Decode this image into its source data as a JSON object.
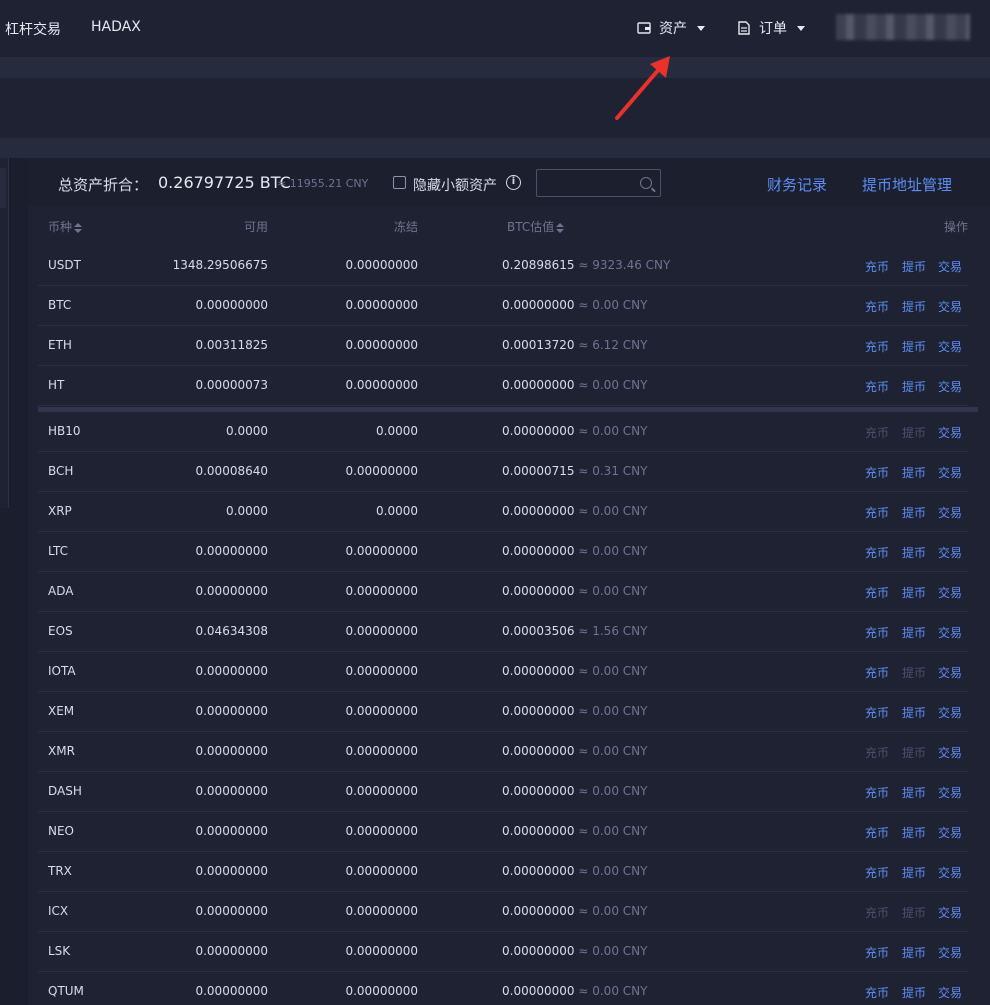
{
  "nav": {
    "margin_trade": "杠杆交易",
    "hadax": "HADAX",
    "assets": "资产",
    "orders": "订单"
  },
  "summary": {
    "label": "总资产折合：",
    "btc_value": "0.26797725 BTC",
    "cny_value": "≈ 11955.21 CNY",
    "hide_small": "隐藏小额资产",
    "search_placeholder": "",
    "finance_records": "财务记录",
    "withdraw_address": "提币地址管理"
  },
  "table": {
    "headers": {
      "coin": "币种",
      "available": "可用",
      "frozen": "冻结",
      "btc_valuation": "BTC估值",
      "actions": "操作"
    },
    "action_labels": {
      "deposit": "充币",
      "withdraw": "提币",
      "trade": "交易"
    },
    "rows": [
      {
        "coin": "USDT",
        "available": "1348.29506675",
        "frozen": "0.00000000",
        "btc": "0.20898615",
        "cny": "≈ 9323.46 CNY",
        "enabled": true
      },
      {
        "coin": "BTC",
        "available": "0.00000000",
        "frozen": "0.00000000",
        "btc": "0.00000000",
        "cny": "≈ 0.00 CNY",
        "enabled": true
      },
      {
        "coin": "ETH",
        "available": "0.00311825",
        "frozen": "0.00000000",
        "btc": "0.00013720",
        "cny": "≈ 6.12 CNY",
        "enabled": true
      },
      {
        "coin": "HT",
        "available": "0.00000073",
        "frozen": "0.00000000",
        "btc": "0.00000000",
        "cny": "≈ 0.00 CNY",
        "enabled": true
      },
      {
        "coin": "HB10",
        "available": "0.0000",
        "frozen": "0.0000",
        "btc": "0.00000000",
        "cny": "≈ 0.00 CNY",
        "enabled": false
      },
      {
        "coin": "BCH",
        "available": "0.00008640",
        "frozen": "0.00000000",
        "btc": "0.00000715",
        "cny": "≈ 0.31 CNY",
        "enabled": true
      },
      {
        "coin": "XRP",
        "available": "0.0000",
        "frozen": "0.0000",
        "btc": "0.00000000",
        "cny": "≈ 0.00 CNY",
        "enabled": true
      },
      {
        "coin": "LTC",
        "available": "0.00000000",
        "frozen": "0.00000000",
        "btc": "0.00000000",
        "cny": "≈ 0.00 CNY",
        "enabled": true
      },
      {
        "coin": "ADA",
        "available": "0.00000000",
        "frozen": "0.00000000",
        "btc": "0.00000000",
        "cny": "≈ 0.00 CNY",
        "enabled": true
      },
      {
        "coin": "EOS",
        "available": "0.04634308",
        "frozen": "0.00000000",
        "btc": "0.00003506",
        "cny": "≈ 1.56 CNY",
        "enabled": true
      },
      {
        "coin": "IOTA",
        "available": "0.00000000",
        "frozen": "0.00000000",
        "btc": "0.00000000",
        "cny": "≈ 0.00 CNY",
        "enabled": "partial"
      },
      {
        "coin": "XEM",
        "available": "0.00000000",
        "frozen": "0.00000000",
        "btc": "0.00000000",
        "cny": "≈ 0.00 CNY",
        "enabled": true
      },
      {
        "coin": "XMR",
        "available": "0.00000000",
        "frozen": "0.00000000",
        "btc": "0.00000000",
        "cny": "≈ 0.00 CNY",
        "enabled": false
      },
      {
        "coin": "DASH",
        "available": "0.00000000",
        "frozen": "0.00000000",
        "btc": "0.00000000",
        "cny": "≈ 0.00 CNY",
        "enabled": true
      },
      {
        "coin": "NEO",
        "available": "0.00000000",
        "frozen": "0.00000000",
        "btc": "0.00000000",
        "cny": "≈ 0.00 CNY",
        "enabled": true
      },
      {
        "coin": "TRX",
        "available": "0.00000000",
        "frozen": "0.00000000",
        "btc": "0.00000000",
        "cny": "≈ 0.00 CNY",
        "enabled": true
      },
      {
        "coin": "ICX",
        "available": "0.00000000",
        "frozen": "0.00000000",
        "btc": "0.00000000",
        "cny": "≈ 0.00 CNY",
        "enabled": false
      },
      {
        "coin": "LSK",
        "available": "0.00000000",
        "frozen": "0.00000000",
        "btc": "0.00000000",
        "cny": "≈ 0.00 CNY",
        "enabled": true
      },
      {
        "coin": "QTUM",
        "available": "0.00000000",
        "frozen": "0.00000000",
        "btc": "0.00000000",
        "cny": "≈ 0.00 CNY",
        "enabled": true
      }
    ]
  },
  "colors": {
    "accent_link": "#5d8ef5",
    "disabled_link": "#4a5070",
    "annotation_arrow": "#e8322b"
  },
  "icons": [
    "wallet-icon",
    "document-icon",
    "chevron-down-icon",
    "info-icon",
    "search-icon",
    "sort-icon",
    "red-arrow"
  ]
}
